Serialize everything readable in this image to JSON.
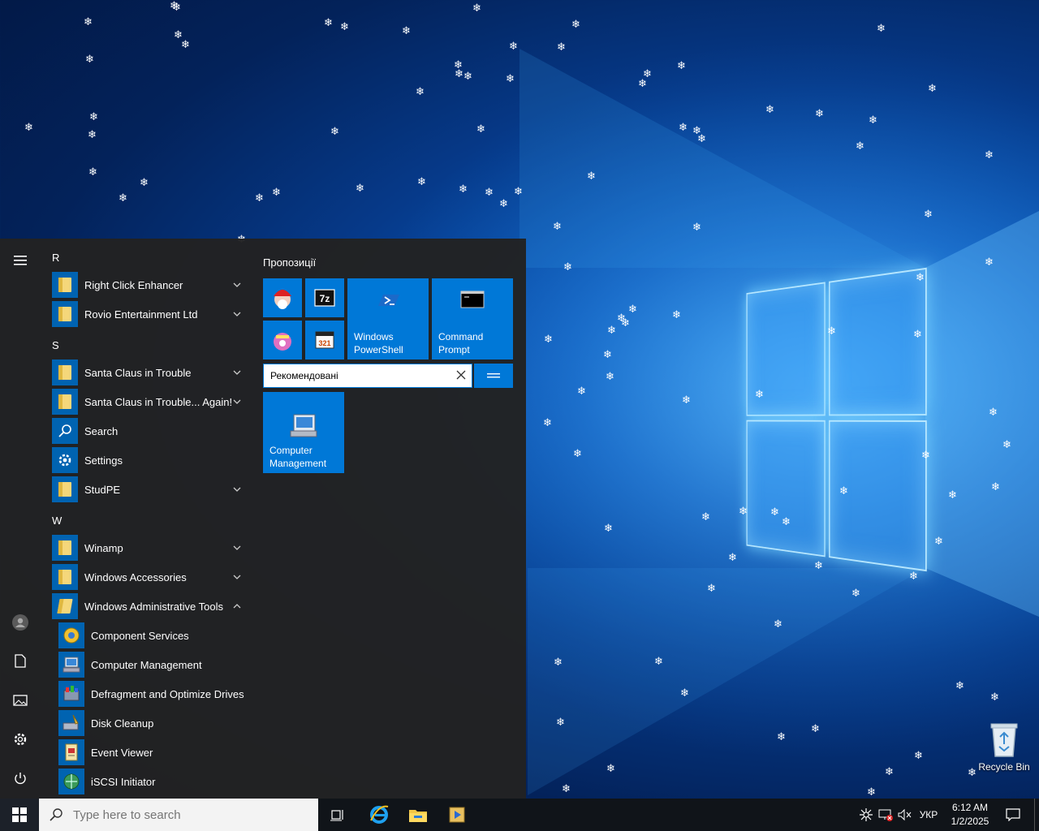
{
  "desktop": {
    "recycle_bin_label": "Recycle Bin"
  },
  "start_menu": {
    "rail": {
      "menu_icon": "hamburger-icon",
      "items": [
        {
          "name": "user",
          "icon": "avatar-icon"
        },
        {
          "name": "documents",
          "icon": "document-icon"
        },
        {
          "name": "pictures",
          "icon": "picture-icon"
        },
        {
          "name": "settings",
          "icon": "gear-icon"
        },
        {
          "name": "power",
          "icon": "power-icon"
        }
      ]
    },
    "app_list": {
      "letters": [
        "R",
        "S",
        "W"
      ],
      "apps": [
        {
          "label": "Right Click Enhancer",
          "expandable": true
        },
        {
          "label": "Rovio Entertainment Ltd",
          "expandable": true
        },
        {
          "label": "Santa Claus in Trouble",
          "expandable": true
        },
        {
          "label": "Santa Claus in Trouble... Again!",
          "expandable": true
        },
        {
          "label": "Search",
          "expandable": false
        },
        {
          "label": "Settings",
          "expandable": false
        },
        {
          "label": "StudPE",
          "expandable": true
        },
        {
          "label": "Winamp",
          "expandable": true
        },
        {
          "label": "Windows Accessories",
          "expandable": true
        },
        {
          "label": "Windows Administrative Tools",
          "expandable": true,
          "expanded": true
        }
      ],
      "admin_tools": [
        "Component Services",
        "Computer Management",
        "Defragment and Optimize Drives",
        "Disk Cleanup",
        "Event Viewer",
        "iSCSI Initiator"
      ]
    },
    "tiles": {
      "group_header": "Пропозиції",
      "powershell_l1": "Windows",
      "powershell_l2": "PowerShell",
      "cmd_l1": "Command",
      "cmd_l2": "Prompt",
      "group_name_value": "Рекомендовані",
      "compmgmt_l1": "Computer",
      "compmgmt_l2": "Management"
    }
  },
  "taskbar": {
    "search_placeholder": "Type here to search",
    "language": "УКР",
    "time": "6:12 AM",
    "date": "1/2/2025",
    "accent": "#0078d7"
  }
}
